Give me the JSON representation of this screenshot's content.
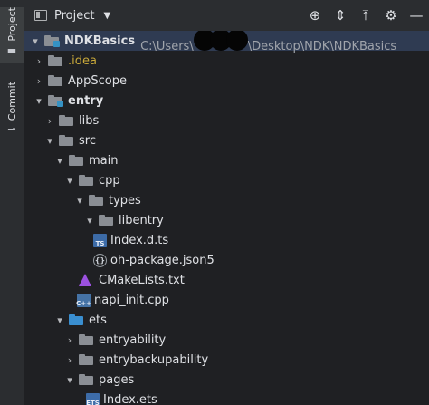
{
  "sidebar": {
    "tabs": [
      {
        "label": "Project",
        "icon": "folder-icon",
        "active": true
      },
      {
        "label": "Commit",
        "icon": "commit-icon",
        "active": false
      }
    ]
  },
  "toolbar": {
    "title": "Project",
    "buttons": [
      "target-icon",
      "expand-all-icon",
      "collapse-all-icon",
      "gear-icon",
      "hide-icon"
    ]
  },
  "tree": {
    "root_label": "NDKBasics",
    "root_path_prefix": "C:\\Users\\",
    "root_path_suffix": "\\Desktop\\NDK\\NDKBasics",
    "items": [
      {
        "label": "NDKBasics",
        "depth": 0,
        "expanded": true,
        "icon": "module-folder",
        "bold": true
      },
      {
        "label": ".idea",
        "depth": 1,
        "expanded": false,
        "icon": "folder",
        "color": "idea"
      },
      {
        "label": "AppScope",
        "depth": 1,
        "expanded": false,
        "icon": "folder"
      },
      {
        "label": "entry",
        "depth": 1,
        "expanded": true,
        "icon": "module-folder",
        "bold": true
      },
      {
        "label": "libs",
        "depth": 2,
        "expanded": false,
        "icon": "folder"
      },
      {
        "label": "src",
        "depth": 2,
        "expanded": true,
        "icon": "folder"
      },
      {
        "label": "main",
        "depth": 3,
        "expanded": true,
        "icon": "folder"
      },
      {
        "label": "cpp",
        "depth": 4,
        "expanded": true,
        "icon": "folder"
      },
      {
        "label": "types",
        "depth": 5,
        "expanded": true,
        "icon": "folder"
      },
      {
        "label": "libentry",
        "depth": 6,
        "expanded": true,
        "icon": "folder"
      },
      {
        "label": "Index.d.ts",
        "depth": 7,
        "icon": "ts-file"
      },
      {
        "label": "oh-package.json5",
        "depth": 7,
        "icon": "json-file"
      },
      {
        "label": "CMakeLists.txt",
        "depth": 5,
        "icon": "cmake-file"
      },
      {
        "label": "napi_init.cpp",
        "depth": 5,
        "icon": "cpp-file"
      },
      {
        "label": "ets",
        "depth": 4,
        "expanded": true,
        "icon": "blue-folder"
      },
      {
        "label": "entryability",
        "depth": 5,
        "expanded": false,
        "icon": "folder"
      },
      {
        "label": "entrybackupability",
        "depth": 5,
        "expanded": false,
        "icon": "folder"
      },
      {
        "label": "pages",
        "depth": 5,
        "expanded": true,
        "icon": "folder"
      },
      {
        "label": "Index.ets",
        "depth": 6,
        "icon": "ets-file"
      }
    ]
  },
  "icons": {
    "ts_badge": "TS",
    "cpp_badge": "C++",
    "ets_badge": "ETS",
    "json_badge": "{}"
  },
  "colors": {
    "selection": "#2f3b52",
    "idea": "#c9a93a",
    "folder_blue": "#3a8fd0"
  }
}
